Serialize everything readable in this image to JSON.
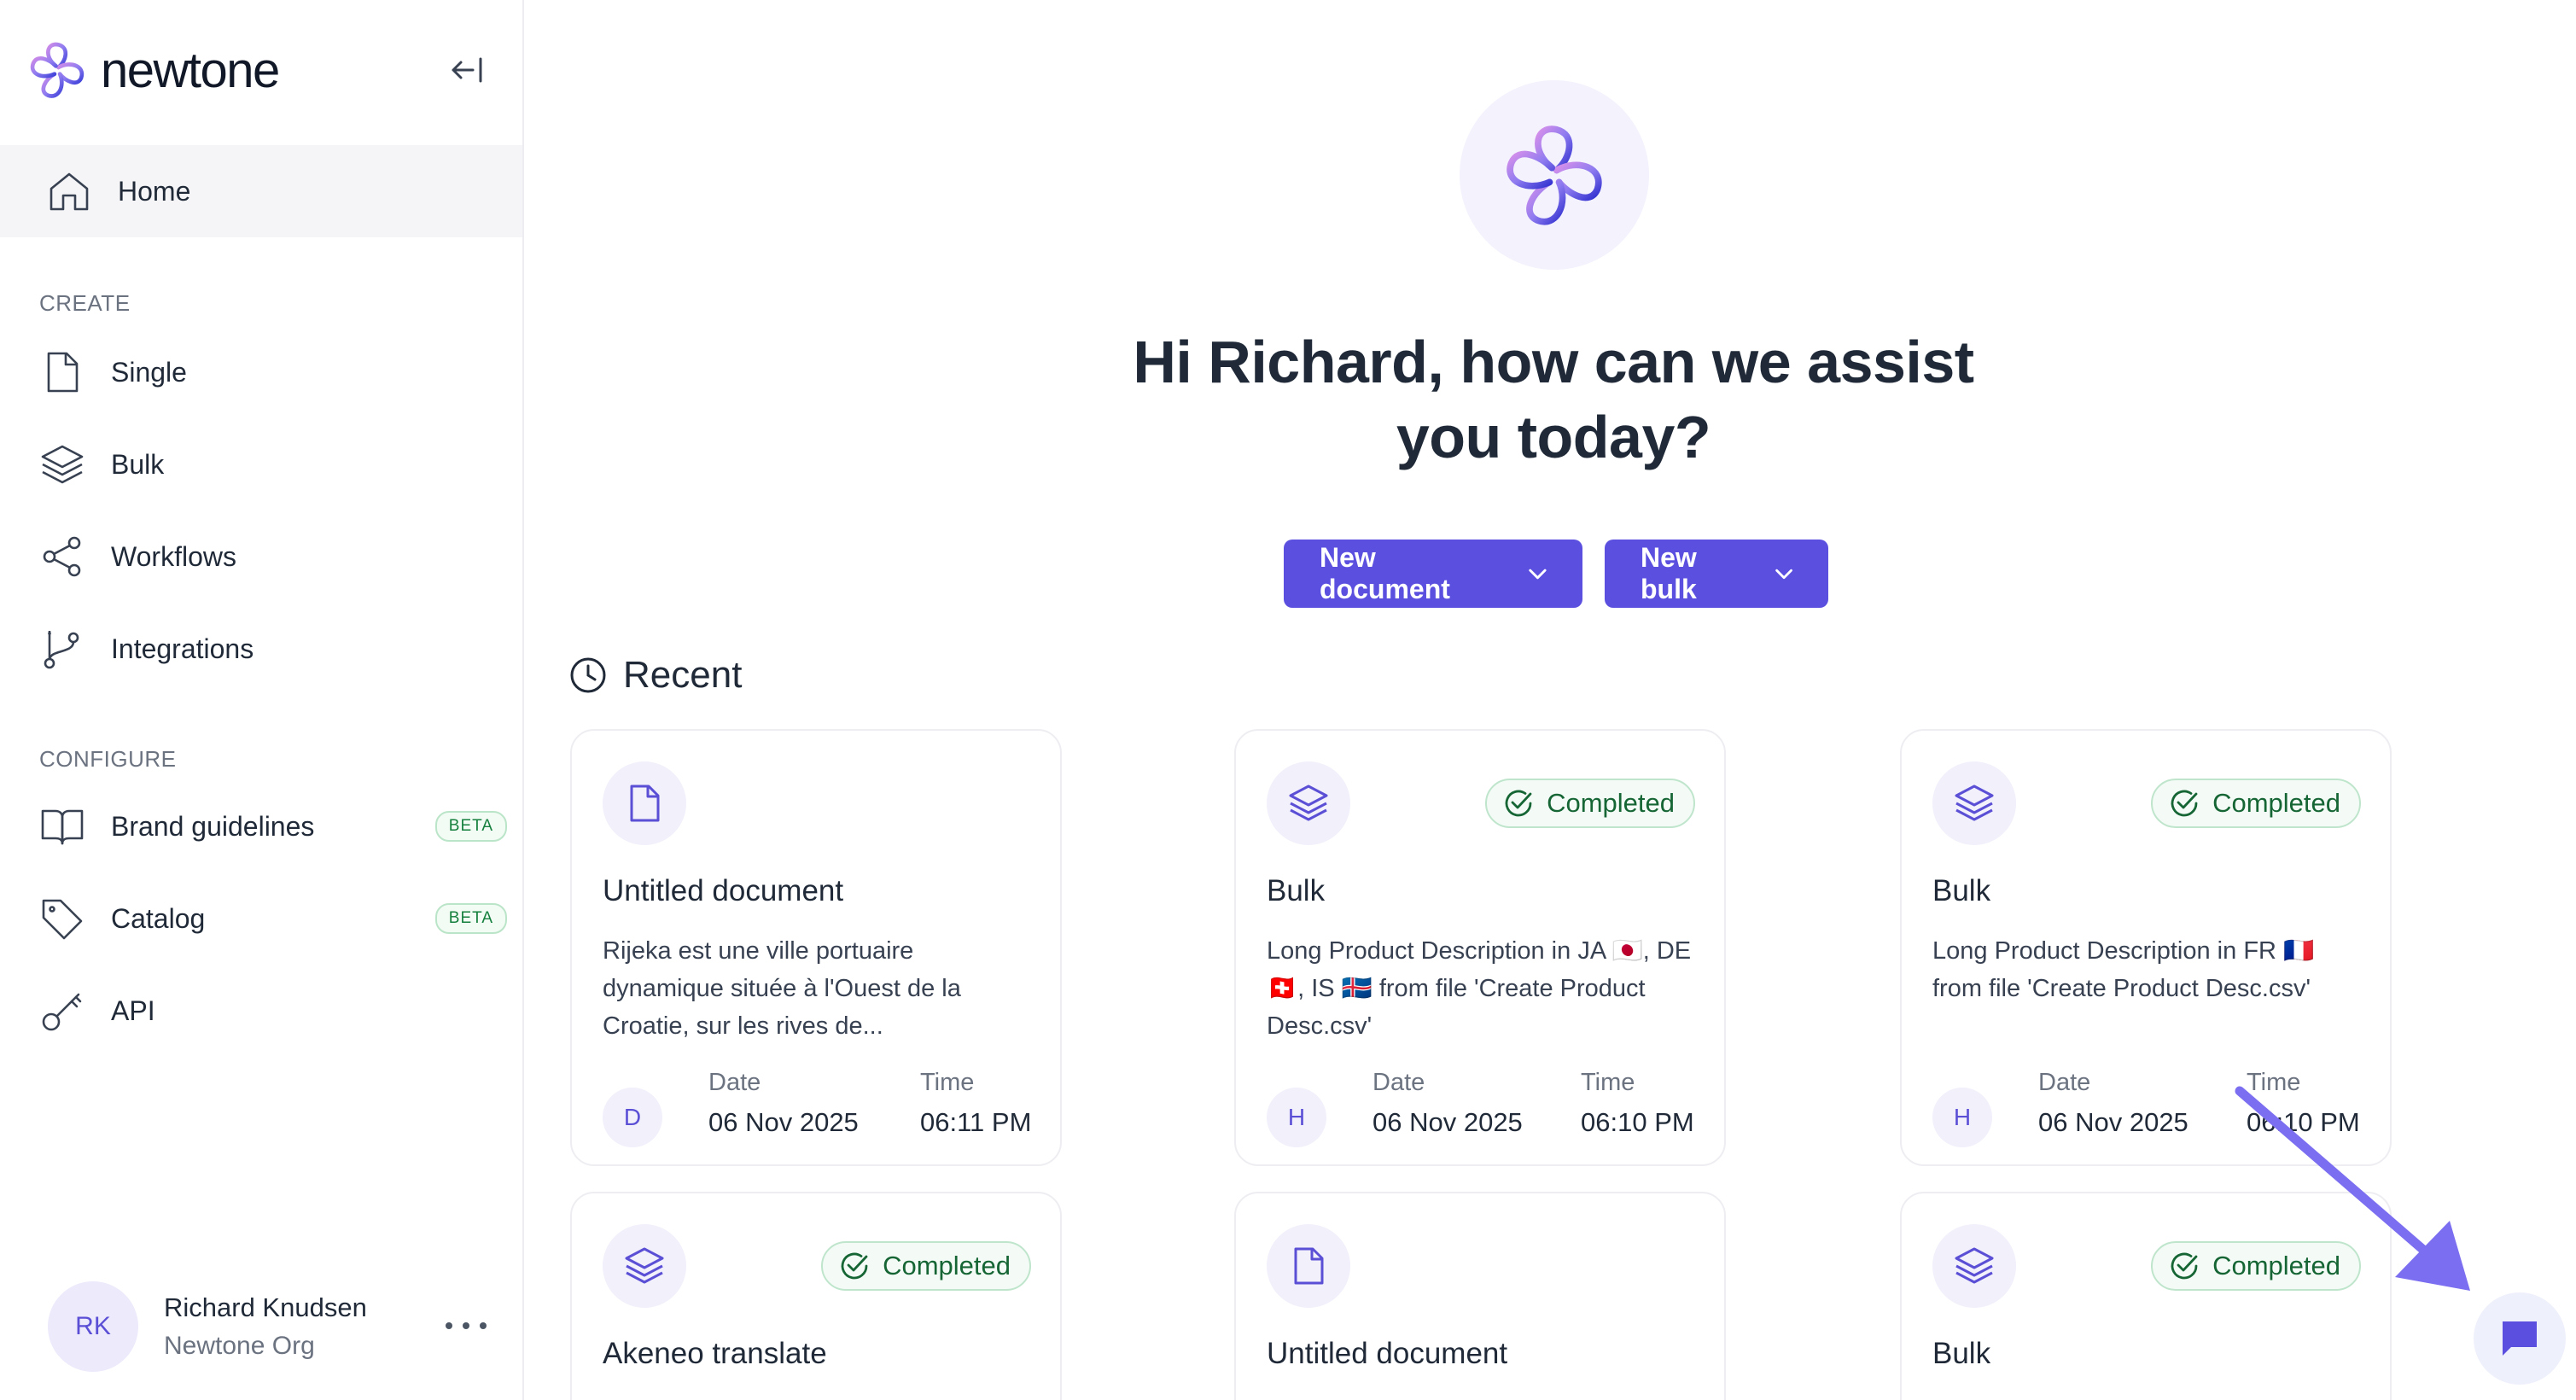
{
  "brand": {
    "name": "newtone",
    "accent": "#5b4fe0"
  },
  "sidebar": {
    "home": {
      "label": "Home",
      "icon": "home-icon"
    },
    "create_section": "CREATE",
    "create_items": [
      {
        "label": "Single",
        "icon": "document-icon"
      },
      {
        "label": "Bulk",
        "icon": "layers-icon"
      },
      {
        "label": "Workflows",
        "icon": "share-icon"
      },
      {
        "label": "Integrations",
        "icon": "git-branch-icon"
      }
    ],
    "configure_section": "CONFIGURE",
    "configure_items": [
      {
        "label": "Brand guidelines",
        "icon": "book-icon",
        "badge": "BETA"
      },
      {
        "label": "Catalog",
        "icon": "tag-icon",
        "badge": "BETA"
      },
      {
        "label": "API",
        "icon": "key-icon"
      }
    ],
    "user": {
      "initials": "RK",
      "name": "Richard Knudsen",
      "org": "Newtone Org"
    }
  },
  "main": {
    "greeting": "Hi Richard, how can we assist you today?",
    "buttons": {
      "new_document": "New document",
      "new_bulk": "New bulk"
    },
    "recent_title": "Recent",
    "cards": [
      {
        "type": "document",
        "title": "Untitled document",
        "description": "Rijeka est une ville portuaire dynamique située à l'Ouest de la Croatie, sur les rives de...",
        "avatar": "D",
        "date_label": "Date",
        "date": "06 Nov 2025",
        "time_label": "Time",
        "time": "06:11 PM"
      },
      {
        "type": "bulk",
        "status": "Completed",
        "title": "Bulk",
        "description": "Long Product Description in JA 🇯🇵, DE 🇨🇭, IS 🇮🇸 from file 'Create Product Desc.csv'",
        "avatar": "H",
        "date_label": "Date",
        "date": "06 Nov 2025",
        "time_label": "Time",
        "time": "06:10 PM"
      },
      {
        "type": "bulk",
        "status": "Completed",
        "title": "Bulk",
        "description": "Long Product Description in FR 🇫🇷 from file 'Create Product Desc.csv'",
        "avatar": "H",
        "date_label": "Date",
        "date": "06 Nov 2025",
        "time_label": "Time",
        "time": "06:10 PM"
      },
      {
        "type": "bulk",
        "status": "Completed",
        "title": "Akeneo translate"
      },
      {
        "type": "document",
        "title": "Untitled document"
      },
      {
        "type": "bulk",
        "status": "Completed",
        "title": "Bulk"
      }
    ]
  },
  "chat": {
    "icon": "chat-icon"
  }
}
